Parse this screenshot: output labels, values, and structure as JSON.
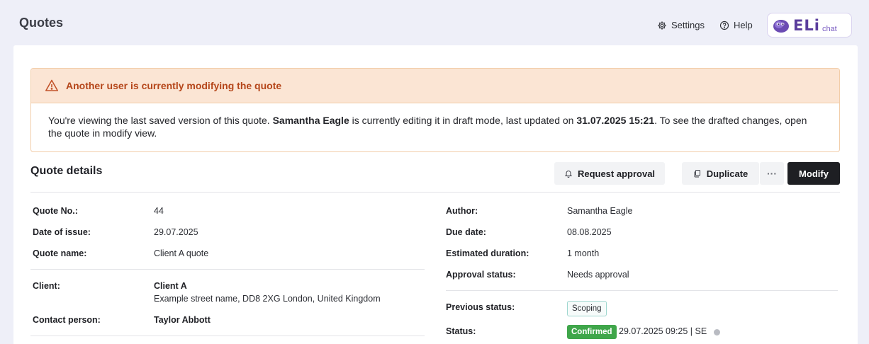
{
  "header": {
    "title": "Quotes",
    "settings_label": "Settings",
    "help_label": "Help",
    "assistant": {
      "word": "ELi",
      "suffix": "chat"
    }
  },
  "alert": {
    "title": "Another user is currently modifying the quote",
    "body_prefix": "You're viewing the last saved version of this quote. ",
    "editor": "Samantha Eagle",
    "body_mid": " is currently editing it in draft mode, last updated on ",
    "updated": "31.07.2025 15:21",
    "body_suffix": ". To see the drafted changes, open the quote in modify view."
  },
  "details": {
    "title": "Quote details",
    "actions": {
      "request_approval": "Request approval",
      "duplicate": "Duplicate",
      "more": "···",
      "modify": "Modify"
    },
    "left": {
      "quote_no": {
        "label": "Quote No.:",
        "value": "44"
      },
      "date_of_issue": {
        "label": "Date of issue:",
        "value": "29.07.2025"
      },
      "quote_name": {
        "label": "Quote name:",
        "value": "Client A quote"
      },
      "client": {
        "label": "Client:",
        "value": "Client A",
        "address": "Example street name, DD8 2XG London, United Kingdom"
      },
      "contact": {
        "label": "Contact person:",
        "value": "Taylor Abbott"
      }
    },
    "right": {
      "author": {
        "label": "Author:",
        "value": "Samantha Eagle"
      },
      "due_date": {
        "label": "Due date:",
        "value": "08.08.2025"
      },
      "duration": {
        "label": "Estimated duration:",
        "value": "1 month"
      },
      "approval": {
        "label": "Approval status:",
        "value": "Needs approval"
      },
      "previous_status": {
        "label": "Previous status:",
        "value": "Scoping"
      },
      "status": {
        "label": "Status:",
        "value": "Confirmed",
        "meta": "29.07.2025 09:25 | SE"
      }
    }
  },
  "colors": {
    "alert_bg": "#fbe5d4",
    "alert_text": "#b5461a",
    "confirmed": "#3fa64a",
    "scoping_border": "#9fd7cf",
    "primary_button": "#1e1f23"
  },
  "icons": [
    "gear-icon",
    "help-circle-icon",
    "warning-triangle-icon",
    "bell-icon",
    "copy-icon",
    "status-dot-icon"
  ]
}
